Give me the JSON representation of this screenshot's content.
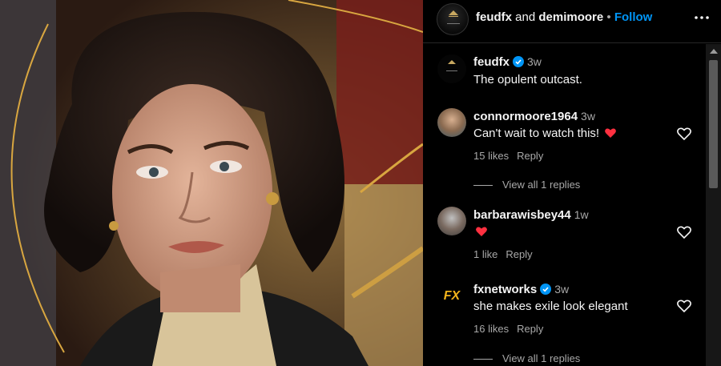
{
  "header": {
    "account1": "feudfx",
    "and_text": "and",
    "account2": "demimoore",
    "separator": "•",
    "follow_label": "Follow"
  },
  "caption": {
    "username": "feudfx",
    "time": "3w",
    "text": "The opulent outcast."
  },
  "comments": [
    {
      "username": "connormoore1964",
      "time": "3w",
      "text": "Can't wait to watch this!",
      "likes": "15 likes",
      "reply_label": "Reply",
      "view_replies": "View all 1 replies"
    },
    {
      "username": "barbarawisbey44",
      "time": "1w",
      "text": "",
      "likes": "1 like",
      "reply_label": "Reply"
    },
    {
      "username": "fxnetworks",
      "time": "3w",
      "text": "she makes exile look elegant",
      "likes": "16 likes",
      "reply_label": "Reply",
      "view_replies": "View all 1 replies",
      "avatar_text": "FX"
    }
  ],
  "colors": {
    "follow": "#0095f6",
    "verified": "#0095f6",
    "heart_red": "#ff3040",
    "fx_logo": "#f2b31b"
  }
}
